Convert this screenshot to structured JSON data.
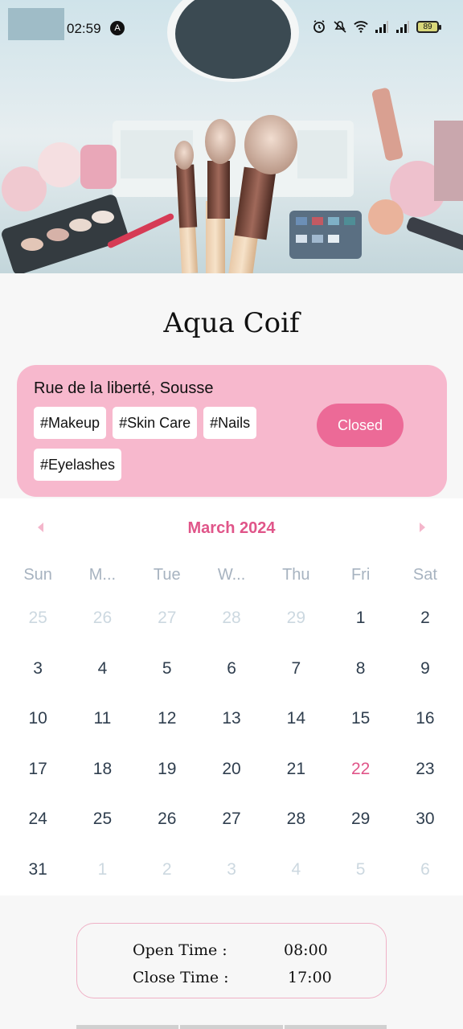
{
  "status_bar": {
    "time": "02:59",
    "notification_glyph": "A",
    "battery": "89",
    "icons": [
      "alarm-icon",
      "mute-icon",
      "wifi-icon",
      "signal-icon",
      "signal-icon",
      "battery-icon"
    ]
  },
  "salon": {
    "name": "Aqua Coif",
    "address": "Rue de la liberté, Sousse",
    "tags": [
      "#Makeup",
      "#Skin Care",
      "#Nails",
      "#Eyelashes"
    ],
    "status": "Closed"
  },
  "calendar": {
    "month_label": "March 2024",
    "weekdays": [
      "Sun",
      "M...",
      "Tue",
      "W...",
      "Thu",
      "Fri",
      "Sat"
    ],
    "days": [
      {
        "label": "25",
        "muted": true
      },
      {
        "label": "26",
        "muted": true
      },
      {
        "label": "27",
        "muted": true
      },
      {
        "label": "28",
        "muted": true
      },
      {
        "label": "29",
        "muted": true
      },
      {
        "label": "1"
      },
      {
        "label": "2"
      },
      {
        "label": "3"
      },
      {
        "label": "4"
      },
      {
        "label": "5"
      },
      {
        "label": "6"
      },
      {
        "label": "7"
      },
      {
        "label": "8"
      },
      {
        "label": "9"
      },
      {
        "label": "10"
      },
      {
        "label": "11"
      },
      {
        "label": "12"
      },
      {
        "label": "13"
      },
      {
        "label": "14"
      },
      {
        "label": "15"
      },
      {
        "label": "16"
      },
      {
        "label": "17"
      },
      {
        "label": "18"
      },
      {
        "label": "19"
      },
      {
        "label": "20"
      },
      {
        "label": "21"
      },
      {
        "label": "22",
        "today": true
      },
      {
        "label": "23"
      },
      {
        "label": "24"
      },
      {
        "label": "25"
      },
      {
        "label": "26"
      },
      {
        "label": "27"
      },
      {
        "label": "28"
      },
      {
        "label": "29"
      },
      {
        "label": "30"
      },
      {
        "label": "31"
      },
      {
        "label": "1",
        "muted": true
      },
      {
        "label": "2",
        "muted": true
      },
      {
        "label": "3",
        "muted": true
      },
      {
        "label": "4",
        "muted": true
      },
      {
        "label": "5",
        "muted": true
      },
      {
        "label": "6",
        "muted": true
      }
    ]
  },
  "hours": {
    "open_label": "Open Time :",
    "open_value": "08:00",
    "close_label": "Close Time :",
    "close_value": "17:00"
  },
  "colors": {
    "accent": "#e05589",
    "card_pink": "#f7b8cd",
    "pill_pink": "#ec6a97"
  }
}
